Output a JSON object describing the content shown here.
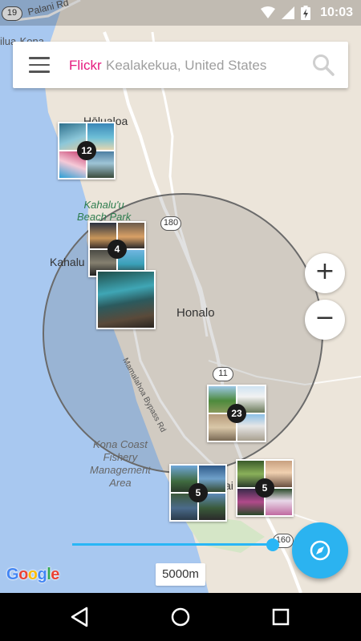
{
  "status_bar": {
    "time": "10:03"
  },
  "search": {
    "brand": "Flickr",
    "location": "Kealakekua, United States"
  },
  "map_labels": {
    "halualoa": "Hōlualoa",
    "kahaluu_park": "Kahalu'u\nBeach Park",
    "kahaluu": "Kahalu",
    "honalo": "Honalo",
    "bypass": "Mamalahoa Bypass Rd",
    "kona_coast": "Kona Coast\nFishery\nManagement\nArea",
    "kealakekua_fragment": "ai",
    "top_road": "Palani Rd",
    "top_town": "ilua-Kona"
  },
  "route_shields": {
    "r19": "19",
    "r180": "180",
    "r11": "11",
    "r160": "160"
  },
  "clusters": [
    {
      "count": "12"
    },
    {
      "count": "4"
    },
    {
      "count": "23"
    },
    {
      "count": "5"
    },
    {
      "count": "5"
    }
  ],
  "zoom": {
    "in": "+",
    "out": "−"
  },
  "radius": {
    "label": "5000m",
    "value_fraction": 0.97
  },
  "attribution": "Google",
  "colors": {
    "accent": "#2bb3f0",
    "brand": "#e5197e",
    "water": "#a8c8f0",
    "land": "#ece5da"
  }
}
